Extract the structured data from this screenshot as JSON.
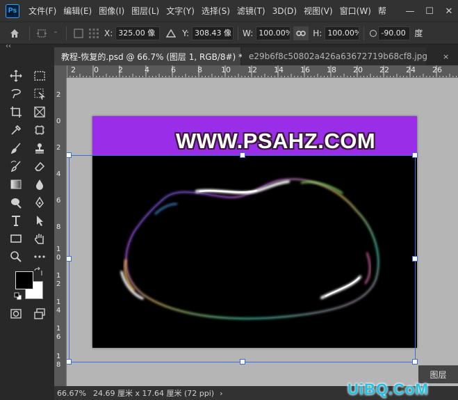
{
  "app": {
    "logo_text": "Ps"
  },
  "menu": [
    "文件(F)",
    "编辑(E)",
    "图像(I)",
    "图层(L)",
    "文字(Y)",
    "选择(S)",
    "滤镜(T)",
    "3D(D)",
    "视图(V)",
    "窗口(W)",
    "帮"
  ],
  "window_controls": {
    "minimize": "—",
    "maximize": "☐",
    "close": "✕"
  },
  "options": {
    "x_label": "X:",
    "x_value": "325.00 像",
    "y_label": "Y:",
    "y_value": "308.43 像",
    "w_label": "W:",
    "w_value": "100.00%",
    "h_label": "H:",
    "h_value": "100.00%",
    "angle_value": "-90.00",
    "angle_unit": "度"
  },
  "panel_toggle": "‹‹",
  "tabs": [
    {
      "label": "教程-恢复的.psd @ 66.7% (图层 1, RGB/8#) *",
      "close": "×"
    },
    {
      "label": "e29b6f8c50802a426a63672719b68cf8.jpg",
      "close": "×"
    }
  ],
  "ruler_top": [
    "2",
    "0",
    "2",
    "4",
    "6",
    "8",
    "10",
    "12",
    "14",
    "16",
    "18",
    "20",
    "22",
    "24",
    "26"
  ],
  "ruler_left": [
    "2",
    "0",
    "2",
    "4",
    "6",
    "8",
    "1",
    "0",
    "1",
    "2",
    "1",
    "4",
    "1",
    "6",
    "1",
    "8"
  ],
  "canvas": {
    "banner_text": "WWW.PSAHZ.COM"
  },
  "layers_panel": {
    "label": "图层"
  },
  "status": {
    "zoom": "66.67%",
    "doc_size": "24.69 厘米 x 17.64 厘米 (72 ppi)",
    "arrow": "›"
  },
  "watermark": "UiBQ.CoM",
  "colors": {
    "banner": "#9a2ee8",
    "selection": "#3b6fd6",
    "workspace": "#b5b5b5"
  }
}
